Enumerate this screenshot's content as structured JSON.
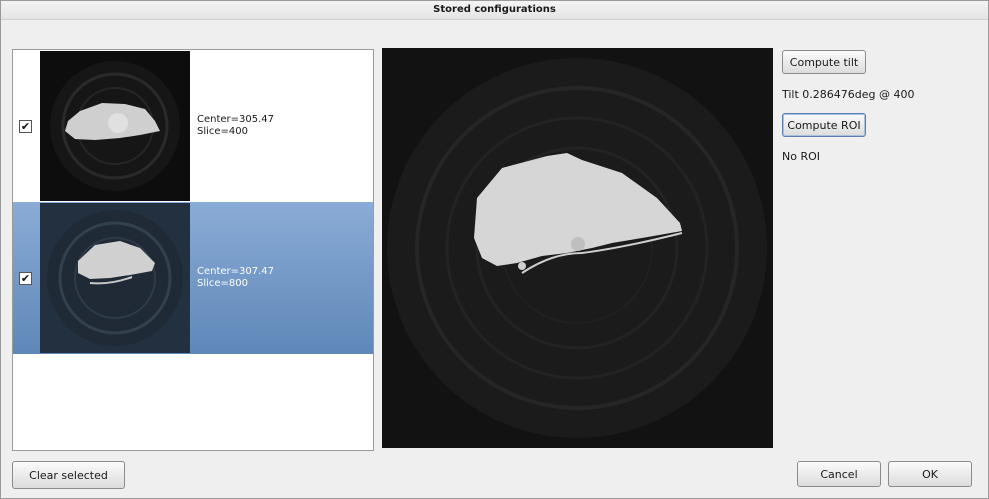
{
  "window": {
    "title": "Stored configurations"
  },
  "configurations": [
    {
      "checked": true,
      "center": "Center=305.47",
      "slice": "Slice=400"
    },
    {
      "checked": true,
      "center": "Center=307.47",
      "slice": "Slice=800"
    }
  ],
  "right_panel": {
    "compute_tilt_label": "Compute tilt",
    "tilt_result": "Tilt 0.286476deg @ 400",
    "compute_roi_label": "Compute ROI",
    "roi_result": "No ROI"
  },
  "footer": {
    "clear_selected_label": "Clear selected",
    "cancel_label": "Cancel",
    "ok_label": "OK"
  },
  "colors": {
    "selection": "#6f95c6",
    "preview_background": "#111111"
  }
}
